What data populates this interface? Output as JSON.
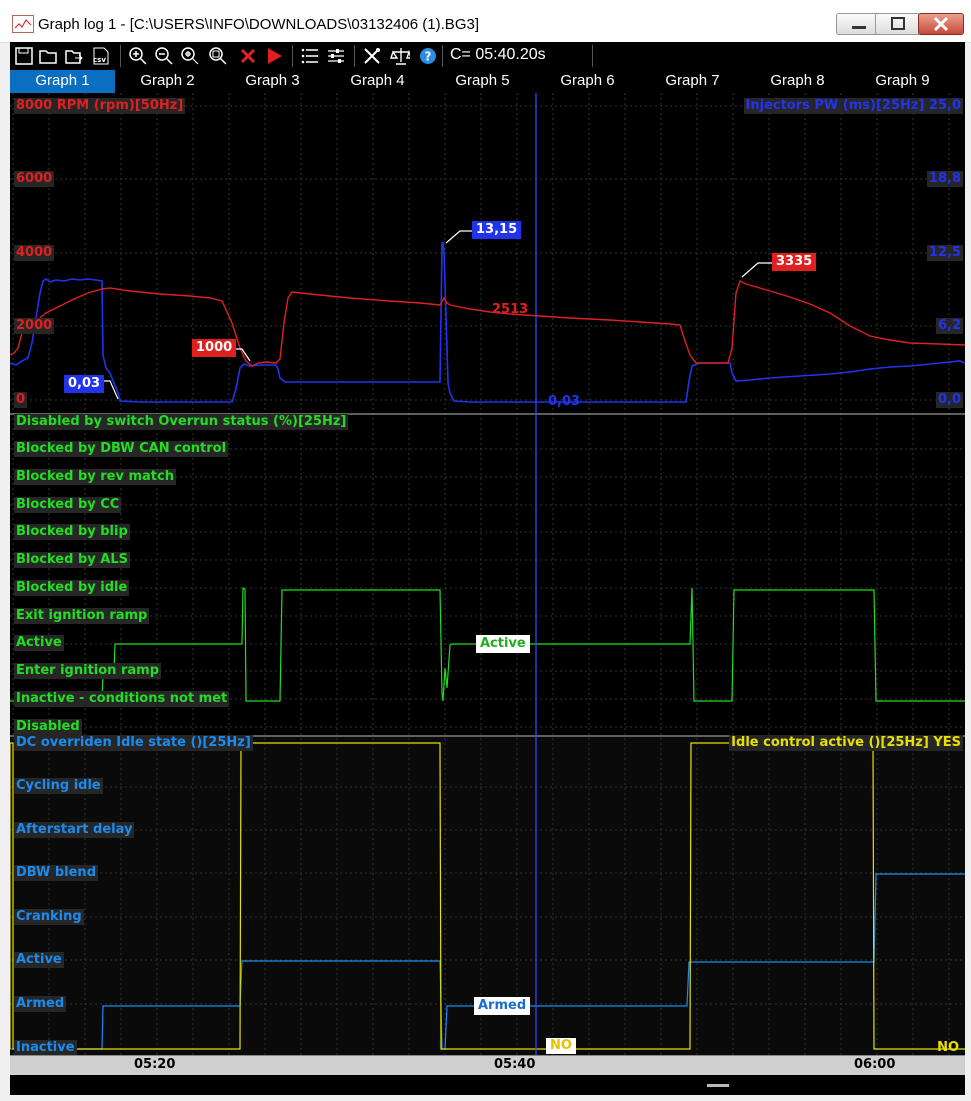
{
  "window": {
    "title": "Graph log 1 - [C:\\USERS\\INFO\\DOWNLOADS\\03132406 (1).BG3]"
  },
  "toolbar": {
    "cursor_time": "C= 05:40.20s",
    "icons": [
      "save-icon",
      "open-icon",
      "open-folder-icon",
      "csv-icon",
      "zoom-in-icon",
      "zoom-out-icon",
      "zoom-fit-icon",
      "zoom-reset-icon",
      "clear-icon",
      "play-icon",
      "list-icon",
      "settings-sliders-icon",
      "tools-icon",
      "scale-icon",
      "help-icon"
    ]
  },
  "tabs": [
    "Graph 1",
    "Graph 2",
    "Graph 3",
    "Graph 4",
    "Graph 5",
    "Graph 6",
    "Graph 7",
    "Graph 8",
    "Graph 9"
  ],
  "active_tab": "Graph 1",
  "panel1": {
    "left_channel": "8000 RPM (rpm)[50Hz]",
    "right_channel": "Injectors PW (ms)[25Hz] 25,0",
    "left_ticks": [
      "6000",
      "4000",
      "2000",
      "0"
    ],
    "right_ticks": [
      "18,8",
      "12,5",
      "6,2",
      "0,0"
    ],
    "tag_rpm_1000": "1000",
    "tag_rpm_3335": "3335",
    "cursor_rpm": "2513",
    "tag_pw_003": "0,03",
    "tag_pw_1315": "13,15",
    "cursor_pw": "0,03"
  },
  "panel2": {
    "title": "Disabled by switch Overrun status (%)[25Hz]",
    "states": [
      "Blocked by DBW CAN control",
      "Blocked by rev match",
      "Blocked by CC",
      "Blocked by blip",
      "Blocked by ALS",
      "Blocked by idle",
      "Exit ignition ramp",
      "Active",
      "Enter ignition ramp",
      "Inactive - conditions not met",
      "Disabled"
    ],
    "cursor_value": "Active"
  },
  "panel3": {
    "left_channel": "DC overriden Idle state ()[25Hz]",
    "right_channel": "Idle control active ()[25Hz] YES",
    "states": [
      "Cycling idle",
      "Afterstart delay",
      "DBW blend",
      "Cranking",
      "Active",
      "Armed",
      "Inactive"
    ],
    "cursor_value": "Armed",
    "cursor_idle_active": "NO",
    "right_bottom": "NO"
  },
  "time_axis": [
    "05:20",
    "05:40",
    "06:00"
  ],
  "colors": {
    "rpm": "#e02020",
    "injector_pw": "#2233ee",
    "overrun": "#22dd22",
    "idle_state": "#1a8cf0",
    "idle_active": "#e8e000",
    "cursor": "#3344ff",
    "active_tab": "#0b6ec0"
  }
}
